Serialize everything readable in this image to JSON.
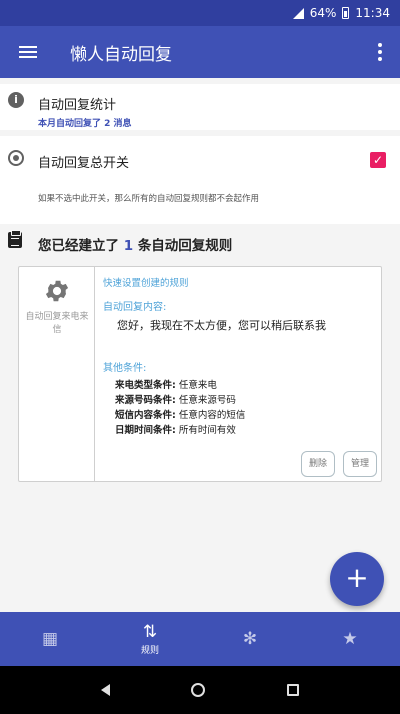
{
  "statusbar": {
    "battery": "64%",
    "time": "11:34"
  },
  "appbar": {
    "title": "懒人自动回复"
  },
  "stats": {
    "title": "自动回复统计",
    "subtitle": "本月自动回复了 2 消息"
  },
  "master_switch": {
    "title": "自动回复总开关",
    "description": "如果不选中此开关，那么所有的自动回复规则都不会起作用",
    "checked": true
  },
  "rules": {
    "header_prefix": "您已经建立了",
    "count": "1",
    "header_suffix": "条自动回复规则",
    "card": {
      "left_label": "自动回复来电来信",
      "quick_title": "快速设置创建的规则",
      "reply_label": "自动回复内容:",
      "reply_text": "您好，我现在不太方便，您可以稍后联系我",
      "other_label": "其他条件:",
      "conditions": [
        {
          "key": "来电类型条件:",
          "value": "任意来电"
        },
        {
          "key": "来源号码条件:",
          "value": "任意来源号码"
        },
        {
          "key": "短信内容条件:",
          "value": "任意内容的短信"
        },
        {
          "key": "日期时间条件:",
          "value": "所有时间有效"
        }
      ],
      "delete_label": "删除",
      "manage_label": "管理"
    }
  },
  "fab": {
    "label": "+"
  },
  "bottom_nav": {
    "rules_label": "规则"
  },
  "colors": {
    "primary": "#3f51b5",
    "primary_dark": "#303f9f",
    "accent": "#e91e63",
    "link": "#4fa3d8"
  },
  "icons": [
    "menu-icon",
    "more-icon",
    "info-icon",
    "power-icon",
    "checkbox-icon",
    "clipboard-icon",
    "gear-icon",
    "plus-icon",
    "tag-icon",
    "swap-icon",
    "settings-icon",
    "star-icon",
    "back-icon",
    "home-icon",
    "recent-icon"
  ]
}
